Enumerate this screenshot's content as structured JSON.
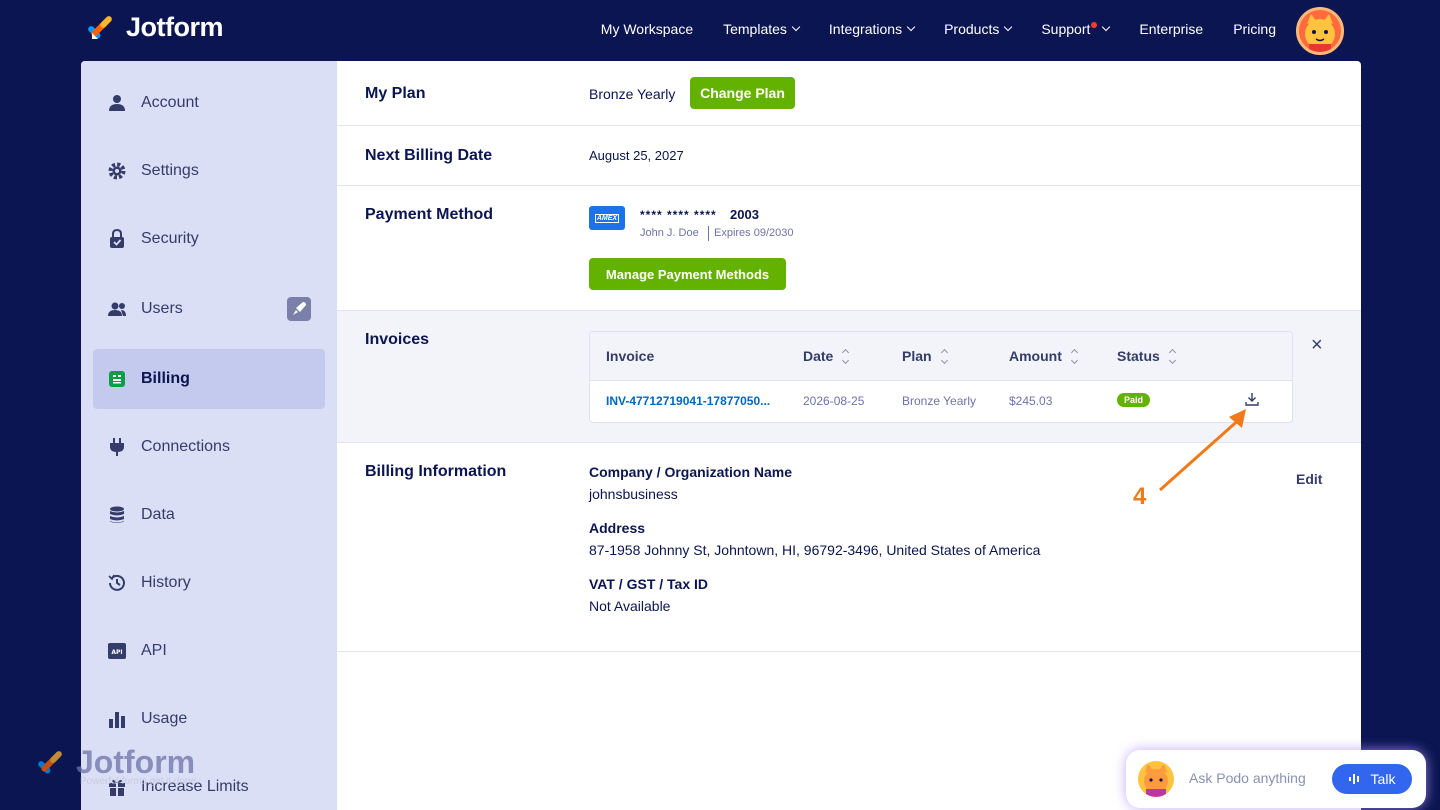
{
  "brand": {
    "name": "Jotform"
  },
  "nav": {
    "items": [
      {
        "label": "My Workspace",
        "dropdown": false
      },
      {
        "label": "Templates",
        "dropdown": true
      },
      {
        "label": "Integrations",
        "dropdown": true
      },
      {
        "label": "Products",
        "dropdown": true
      },
      {
        "label": "Support",
        "dropdown": true,
        "notification": true
      },
      {
        "label": "Enterprise",
        "dropdown": false
      },
      {
        "label": "Pricing",
        "dropdown": false
      }
    ]
  },
  "sidebar": {
    "items": [
      {
        "label": "Account",
        "icon": "user-icon"
      },
      {
        "label": "Settings",
        "icon": "gear-icon"
      },
      {
        "label": "Security",
        "icon": "lock-icon"
      },
      {
        "label": "Users",
        "icon": "users-icon"
      },
      {
        "label": "Billing",
        "icon": "billing-icon",
        "active": true
      },
      {
        "label": "Connections",
        "icon": "plug-icon"
      },
      {
        "label": "Data",
        "icon": "database-icon"
      },
      {
        "label": "History",
        "icon": "history-icon"
      },
      {
        "label": "API",
        "icon": "api-icon"
      },
      {
        "label": "Usage",
        "icon": "bar-chart-icon"
      },
      {
        "label": "Increase Limits",
        "icon": "gift-icon"
      }
    ]
  },
  "billing": {
    "my_plan": {
      "label": "My Plan",
      "value": "Bronze Yearly",
      "button": "Change Plan"
    },
    "next_billing": {
      "label": "Next Billing Date",
      "value": "August 25, 2027"
    },
    "payment": {
      "label": "Payment Method",
      "card_brand": "AMEX",
      "card_mask": "**** **** ****",
      "card_last4": "2003",
      "holder": "John J. Doe",
      "expires": "Expires 09/2030",
      "button": "Manage Payment Methods"
    },
    "invoices": {
      "label": "Invoices",
      "close": "×",
      "headers": [
        "Invoice",
        "Date",
        "Plan",
        "Amount",
        "Status"
      ],
      "rows": [
        {
          "invoice": "INV-47712719041-17877050...",
          "date": "2026-08-25",
          "plan": "Bronze Yearly",
          "amount": "$245.03",
          "status": "Paid"
        }
      ]
    },
    "info": {
      "label": "Billing Information",
      "edit": "Edit",
      "company_label": "Company / Organization Name",
      "company": "johnsbusiness",
      "address_label": "Address",
      "address": "87-1958 Johnny St, Johntown, HI, 96792-3496, United States of America",
      "vat_label": "VAT / GST / Tax ID",
      "vat": "Not Available"
    }
  },
  "annotation": {
    "step": "4",
    "color": "#f07a1a"
  },
  "podo": {
    "placeholder": "Ask Podo anything",
    "talk": "Talk"
  },
  "watermark": {
    "name": "Jotform",
    "tagline": "Powerful forms get it done."
  },
  "colors": {
    "navy": "#0a1551",
    "green": "#64b200",
    "link": "#0066c3",
    "sidebar": "#dbdff5"
  }
}
